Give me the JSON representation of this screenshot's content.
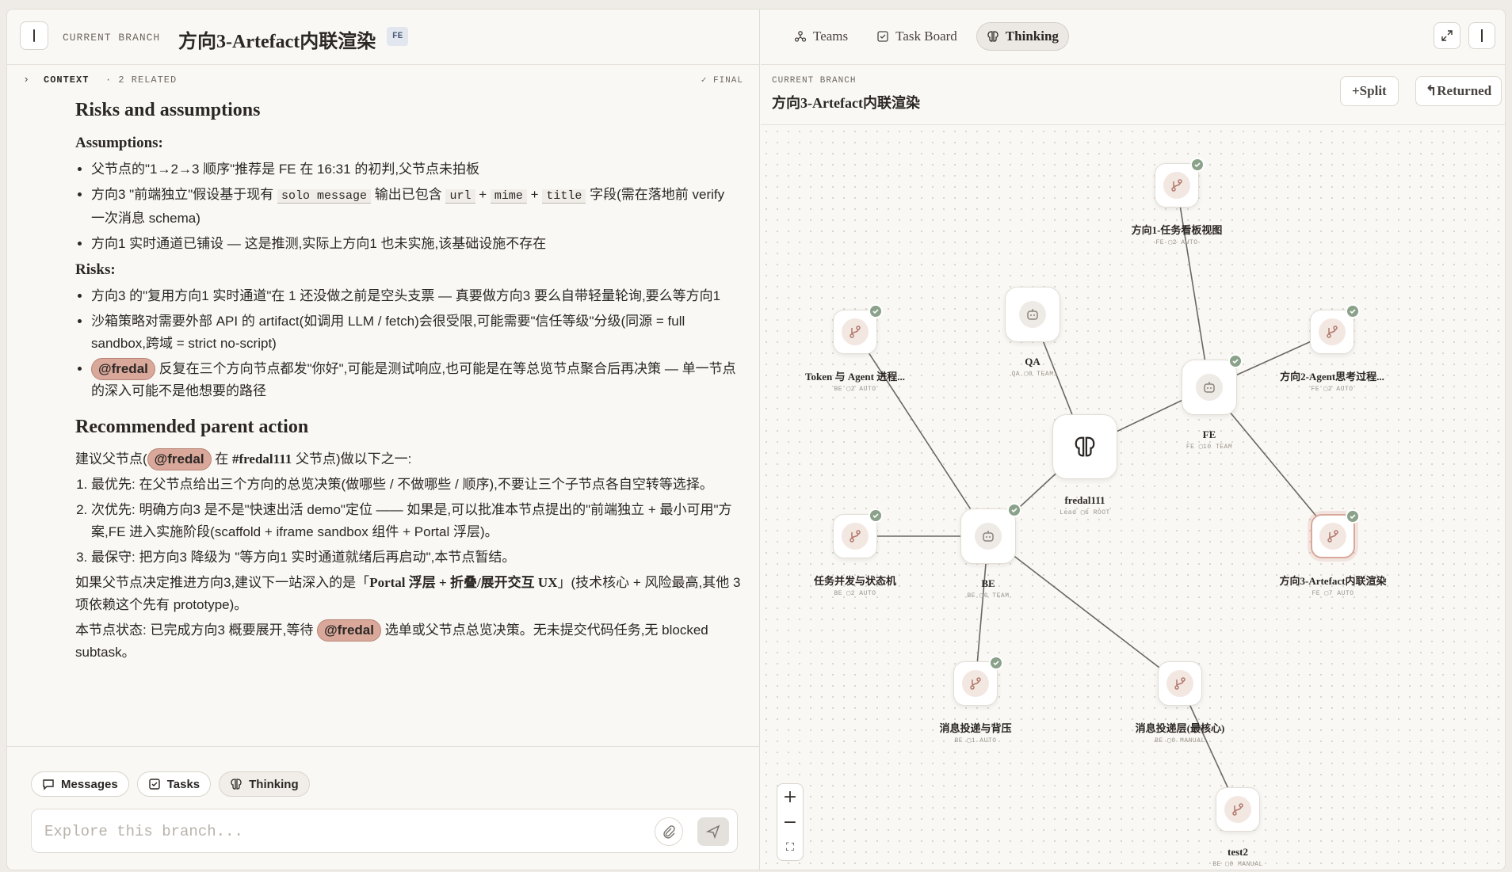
{
  "left": {
    "header": {
      "label": "CURRENT BRANCH",
      "title": "方向3-Artefact内联渲染",
      "badge": "FE"
    },
    "context": {
      "label": "CONTEXT",
      "related": "· 2 RELATED",
      "status": "FINAL"
    },
    "doc": {
      "h1": "Risks and assumptions",
      "assumptions_label": "Assumptions",
      "assumptions": [
        "父节点的\"1→2→3 顺序\"推荐是 FE 在 16:31 的初判,父节点未拍板",
        "verify 一次消息 schema)",
        "方向1 实时通道已铺设 — 这是推测,实际上方向1 也未实施,该基础设施不存在"
      ],
      "a2": {
        "pre": "方向3 \"前端独立\"假设基于现有",
        "c1": "solo message",
        "mid": "输出已包含",
        "c2": "url",
        "plus": "+",
        "c3": "mime",
        "c4": "title",
        "post": "字段(需在落地前"
      },
      "risks_label": "Risks",
      "risks": [
        "方向3 的\"复用方向1 实时通道\"在 1 还没做之前是空头支票 — 真要做方向3 要么自带轻量轮询,要么等方向1",
        "沙箱策略对需要外部 API 的 artifact(如调用 LLM / fetch)会很受限,可能需要\"信任等级\"分级(同源 = full sandbox,跨域 = strict no-script)",
        "反复在三个方向节点都发\"你好\",可能是测试响应,也可能是在等总览节点聚合后再决策 — 单一节点的深入可能不是他想要的路径"
      ],
      "mention": "@fredal",
      "h2": "Recommended parent action",
      "suggest_pre": "建议父节点(",
      "suggest_mid": "在",
      "suggest_node": "#fredal111",
      "suggest_post": "父节点)做以下之一:",
      "steps": [
        "最优先: 在父节点给出三个方向的总览决策(做哪些 / 不做哪些 / 顺序),不要让三个子节点各自空转等选择。",
        "次优先: 明确方向3 是不是\"快速出活 demo\"定位 —— 如果是,可以批准本节点提出的\"前端独立 + 最小可用\"方案,FE 进入实施阶段(scaffold + iframe sandbox 组件 + Portal 浮层)。",
        "最保守: 把方向3 降级为 \"等方向1 实时通道就绪后再启动\",本节点暂结。"
      ],
      "para1_pre": "如果父节点决定推进方向3,建议下一站深入的是「",
      "para1_bold": "Portal 浮层 + 折叠/展开交互 UX",
      "para1_post": "」(技术核心 + 风险最高,其他 3 项依赖这个先有 prototype)。",
      "para2_pre": "本节点状态: 已完成方向3 概要展开,等待",
      "para2_post": "选单或父节点总览决策。无未提交代码任务,无 blocked subtask。"
    },
    "chips": {
      "messages": "Messages",
      "tasks": "Tasks",
      "thinking": "Thinking"
    },
    "composer": {
      "placeholder": "Explore this branch..."
    }
  },
  "right": {
    "tabs": {
      "teams": "Teams",
      "taskboard": "Task Board",
      "thinking": "Thinking"
    },
    "sub": {
      "label": "CURRENT BRANCH",
      "title": "方向3-Artefact内联渲染",
      "split": "+Split",
      "returned": "↰Returned"
    },
    "nodes": [
      {
        "id": "d1",
        "name": "方向1-任务看板视图",
        "meta": "FE ▢2 AUTO",
        "kind": "branch",
        "checked": true
      },
      {
        "id": "qa",
        "name": "QA",
        "meta": "QA ▢0 TEAM",
        "kind": "bot",
        "checked": false
      },
      {
        "id": "token",
        "name": "Token 与 Agent 进程...",
        "meta": "BE ▢2 AUTO",
        "kind": "branch",
        "checked": true
      },
      {
        "id": "d2",
        "name": "方向2-Agent思考过程...",
        "meta": "FE ▢2 AUTO",
        "kind": "branch",
        "checked": true
      },
      {
        "id": "fe",
        "name": "FE",
        "meta": "FE ▢10 TEAM",
        "kind": "bot",
        "checked": true
      },
      {
        "id": "root",
        "name": "fredal111",
        "meta": "Lead ▢6 ROOT",
        "kind": "root",
        "checked": false
      },
      {
        "id": "task",
        "name": "任务并发与状态机",
        "meta": "BE ▢2 AUTO",
        "kind": "branch",
        "checked": true
      },
      {
        "id": "be",
        "name": "BE",
        "meta": "BE ▢6 TEAM",
        "kind": "bot",
        "checked": true
      },
      {
        "id": "d3",
        "name": "方向3-Artefact内联渲染",
        "meta": "FE ▢7 AUTO",
        "kind": "branch",
        "checked": true,
        "selected": true
      },
      {
        "id": "msg1",
        "name": "消息投递与背压",
        "meta": "BE ▢1 AUTO",
        "kind": "branch",
        "checked": true
      },
      {
        "id": "msg2",
        "name": "消息投递层(最核心)",
        "meta": "BE ▢0 MANUAL",
        "kind": "branch",
        "checked": false
      },
      {
        "id": "test2",
        "name": "test2",
        "meta": "BE ▢0 MANUAL",
        "kind": "branch",
        "checked": false
      }
    ],
    "edges": [
      [
        "root",
        "fe"
      ],
      [
        "root",
        "be"
      ],
      [
        "root",
        "qa"
      ],
      [
        "fe",
        "d1"
      ],
      [
        "fe",
        "d2"
      ],
      [
        "fe",
        "d3"
      ],
      [
        "be",
        "token"
      ],
      [
        "be",
        "task"
      ],
      [
        "be",
        "msg1"
      ],
      [
        "be",
        "msg2"
      ],
      [
        "msg2",
        "test2"
      ]
    ]
  },
  "colors": {
    "accent": "#d9a89b",
    "check": "#8aa18a",
    "edge": "#6b6661"
  }
}
